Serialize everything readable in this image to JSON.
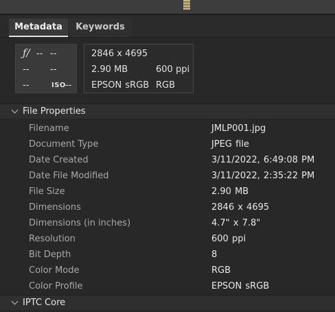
{
  "tabs": [
    {
      "label": "Metadata",
      "active": true
    },
    {
      "label": "Keywords",
      "active": false
    }
  ],
  "camera_data": {
    "fstop_glyph": "ƒ/",
    "fstop": "--",
    "shutter": "--",
    "exposure_bias": "--",
    "focal_length": "--",
    "white_balance": "--",
    "iso_glyph": "ISO",
    "iso": "--",
    "dimensions": "2846 x 4695",
    "file_size": "2.90 MB",
    "resolution": "600 ppi",
    "color_profile": "EPSON  sRGB",
    "color_mode": "RGB"
  },
  "sections": {
    "file_properties": {
      "title": "File Properties",
      "expanded": true,
      "rows": [
        {
          "label": "Filename",
          "value": "JMLP001.jpg"
        },
        {
          "label": "Document Type",
          "value": "JPEG file"
        },
        {
          "label": "Date Created",
          "value": "3/11/2022, 6:49:08 PM"
        },
        {
          "label": "Date File Modified",
          "value": "3/11/2022, 2:35:22 PM"
        },
        {
          "label": "File Size",
          "value": "2.90 MB"
        },
        {
          "label": "Dimensions",
          "value": "2846 x 4695"
        },
        {
          "label": "Dimensions (in inches)",
          "value": "4.7\" x 7.8\""
        },
        {
          "label": "Resolution",
          "value": "600 ppi"
        },
        {
          "label": "Bit Depth",
          "value": "8"
        },
        {
          "label": "Color Mode",
          "value": "RGB"
        },
        {
          "label": "Color Profile",
          "value": "EPSON  sRGB"
        }
      ]
    },
    "iptc_core": {
      "title": "IPTC Core",
      "expanded": true
    }
  },
  "colors": {
    "panel_bg": "#282828",
    "header_bg": "#2f2f2f",
    "label_text": "#a8a8a8",
    "value_text": "#e8e8e8"
  }
}
